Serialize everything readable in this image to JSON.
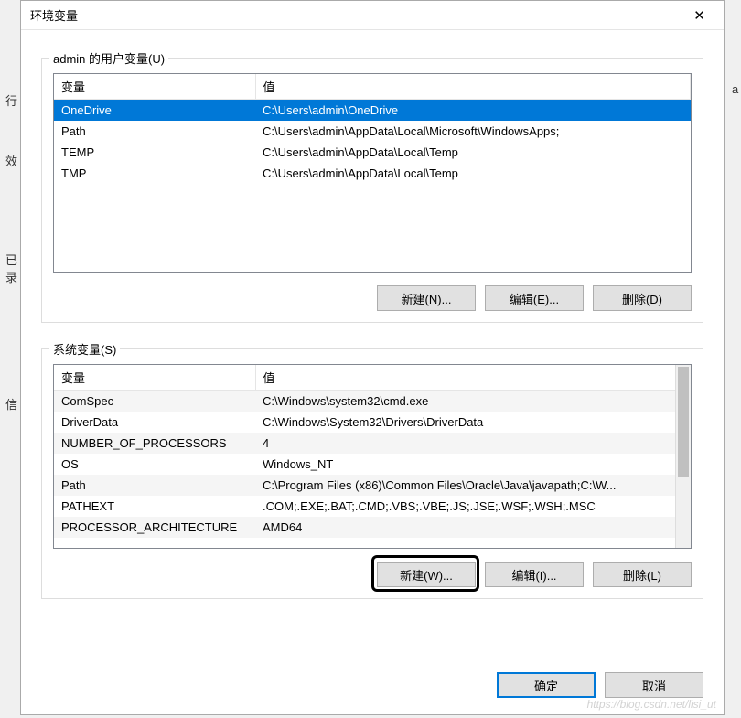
{
  "window": {
    "title": "环境变量",
    "close_glyph": "✕"
  },
  "user_group": {
    "legend": "admin 的用户变量(U)",
    "headers": {
      "var": "变量",
      "val": "值"
    },
    "rows": [
      {
        "var": "OneDrive",
        "val": "C:\\Users\\admin\\OneDrive",
        "selected": true
      },
      {
        "var": "Path",
        "val": "C:\\Users\\admin\\AppData\\Local\\Microsoft\\WindowsApps;"
      },
      {
        "var": "TEMP",
        "val": "C:\\Users\\admin\\AppData\\Local\\Temp"
      },
      {
        "var": "TMP",
        "val": "C:\\Users\\admin\\AppData\\Local\\Temp"
      }
    ],
    "buttons": {
      "new": "新建(N)...",
      "edit": "编辑(E)...",
      "delete": "删除(D)"
    }
  },
  "system_group": {
    "legend": "系统变量(S)",
    "headers": {
      "var": "变量",
      "val": "值"
    },
    "rows": [
      {
        "var": "ComSpec",
        "val": "C:\\Windows\\system32\\cmd.exe",
        "alt": true
      },
      {
        "var": "DriverData",
        "val": "C:\\Windows\\System32\\Drivers\\DriverData"
      },
      {
        "var": "NUMBER_OF_PROCESSORS",
        "val": "4",
        "alt": true
      },
      {
        "var": "OS",
        "val": "Windows_NT"
      },
      {
        "var": "Path",
        "val": "C:\\Program Files (x86)\\Common Files\\Oracle\\Java\\javapath;C:\\W...",
        "alt": true
      },
      {
        "var": "PATHEXT",
        "val": ".COM;.EXE;.BAT;.CMD;.VBS;.VBE;.JS;.JSE;.WSF;.WSH;.MSC"
      },
      {
        "var": "PROCESSOR_ARCHITECTURE",
        "val": "AMD64",
        "alt": true
      }
    ],
    "buttons": {
      "new": "新建(W)...",
      "edit": "编辑(I)...",
      "delete": "删除(L)"
    }
  },
  "footer": {
    "ok": "确定",
    "cancel": "取消"
  },
  "bg": {
    "t1": "行",
    "t2": "效",
    "t3": "已",
    "t4": "录",
    "t5": "信",
    "t6": "a"
  }
}
